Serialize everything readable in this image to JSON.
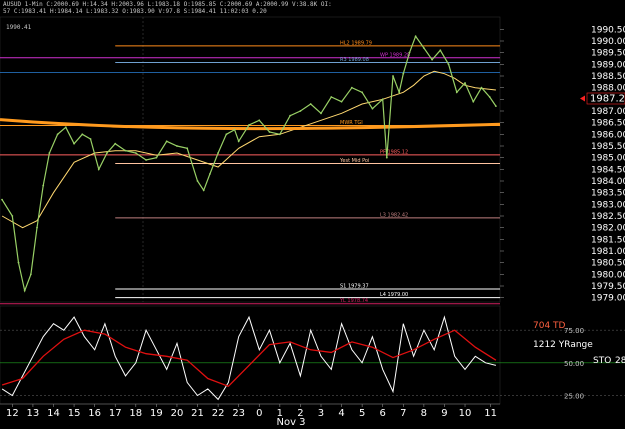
{
  "header": {
    "line1": "AUSUD 1-Min  C:2000.69  H:14.34  H:2003.96  L:1983.18  O:1985.85  C:2000.69  A:2000.99  V:38.8K  OI:",
    "line2": "57  C:1983.41  H:1984.14  L:1983.32  O:1983.90  V:97.8  S:1984.41  11:02:03  0.20"
  },
  "colors": {
    "background": "#000000",
    "price_line": "#99d066",
    "ma_orange": "#ff9a1e",
    "ma_yellow": "#ffd870",
    "osc_line": "#ffffff",
    "osc_signal": "#e01010",
    "osc_grid_green": "#1fa11f",
    "axis_text": "#ffffff",
    "last_price_box": "#ff2222"
  },
  "chart_data": [
    {
      "type": "line",
      "title": "",
      "ylim": [
        1978.9,
        1990.9
      ],
      "y_ticks": [
        "1990.50",
        "1990.00",
        "1989.50",
        "1989.00",
        "1988.50",
        "1988.00",
        "1987.50",
        "1987.00",
        "1986.50",
        "1986.00",
        "1985.50",
        "1985.00",
        "1984.50",
        "1984.00",
        "1983.50",
        "1983.00",
        "1982.50",
        "1982.00",
        "1981.50",
        "1981.00",
        "1980.50",
        "1980.00",
        "1979.50",
        "1979.00"
      ],
      "y_tick_values": [
        1990.5,
        1990.0,
        1989.5,
        1989.0,
        1988.5,
        1988.0,
        1987.5,
        1987.0,
        1986.5,
        1986.0,
        1985.5,
        1985.0,
        1984.5,
        1984.0,
        1983.5,
        1983.0,
        1982.5,
        1982.0,
        1981.5,
        1981.0,
        1980.5,
        1980.0,
        1979.5,
        1979.0
      ],
      "last_price": "1987.21",
      "last_price_value": 1987.21,
      "corner_label": "1990.41",
      "x_range": [
        11.4,
        35.7
      ],
      "price_series": {
        "x": [
          11.5,
          12,
          12.3,
          12.6,
          12.9,
          13.2,
          13.5,
          13.8,
          14.2,
          14.6,
          15,
          15.4,
          15.8,
          16.2,
          16.6,
          17,
          17.5,
          18,
          18.5,
          19,
          19.5,
          20,
          20.5,
          21,
          21.3,
          21.6,
          22,
          22.4,
          22.8,
          23,
          23.5,
          24,
          24.5,
          25,
          25.5,
          26,
          26.5,
          27,
          27.5,
          28,
          28.5,
          29,
          29.5,
          30,
          30.2,
          30.5,
          30.8,
          31,
          31.3,
          31.6,
          32,
          32.4,
          32.8,
          33.2,
          33.6,
          34,
          34.4,
          34.8,
          35.2,
          35.5
        ],
        "y": [
          1983.2,
          1982.5,
          1980.5,
          1979.3,
          1980.0,
          1982.0,
          1983.8,
          1985.2,
          1986.0,
          1986.3,
          1985.6,
          1986.0,
          1985.8,
          1984.5,
          1985.2,
          1985.6,
          1985.3,
          1985.2,
          1984.9,
          1985.0,
          1985.7,
          1985.5,
          1985.4,
          1984.0,
          1983.6,
          1984.3,
          1985.2,
          1986.0,
          1986.2,
          1985.7,
          1986.4,
          1986.6,
          1986.1,
          1986.0,
          1986.8,
          1987.0,
          1987.3,
          1986.9,
          1987.6,
          1987.4,
          1988.0,
          1987.8,
          1987.1,
          1987.5,
          1985.0,
          1988.5,
          1987.8,
          1988.6,
          1989.5,
          1990.2,
          1989.7,
          1989.2,
          1989.6,
          1989.0,
          1987.8,
          1988.2,
          1987.4,
          1988.0,
          1987.6,
          1987.21
        ]
      },
      "ma_series": {
        "x": [
          11.5,
          12.5,
          13.2,
          14,
          15,
          16,
          17,
          18,
          19,
          20,
          21,
          22,
          23,
          24,
          25,
          26,
          27,
          28,
          29,
          30,
          31,
          31.5,
          32,
          32.5,
          33,
          33.5,
          34,
          34.5,
          35.5
        ],
        "y": [
          1982.5,
          1982.0,
          1982.3,
          1983.5,
          1984.8,
          1985.2,
          1985.3,
          1985.3,
          1985.1,
          1985.2,
          1984.9,
          1984.6,
          1985.4,
          1985.9,
          1986.0,
          1986.3,
          1986.6,
          1986.9,
          1987.3,
          1987.5,
          1987.8,
          1988.1,
          1988.5,
          1988.7,
          1988.6,
          1988.4,
          1988.1,
          1988.0,
          1987.9
        ]
      },
      "levels": [
        {
          "label": "HL2 1989.79",
          "value": 1989.79,
          "color": "#ff8c1a",
          "x_start": 17.0
        },
        {
          "label": "WP 1989.28",
          "value": 1989.28,
          "color": "#d030d0",
          "x_start": 11.4
        },
        {
          "label": "R3 1989.08",
          "value": 1989.08,
          "color": "#6fa0d0",
          "x_start": 17.0
        },
        {
          "label": "",
          "value": 1988.65,
          "color": "#1f5f9f",
          "x_start": 11.4
        },
        {
          "label": "MWR TGI",
          "value": 1986.38,
          "color": "#ff9a1e",
          "x_start": 11.4
        },
        {
          "label": "PF 1985.12",
          "value": 1985.12,
          "color": "#ff5f5f",
          "x_start": 11.4
        },
        {
          "label": "Yest Mid Poi",
          "value": 1984.75,
          "color": "#ffc4a0",
          "x_start": 17.0
        },
        {
          "label": "L3 1982.42",
          "value": 1982.42,
          "color": "#c08080",
          "x_start": 17.0
        },
        {
          "label": "S1 1979.37",
          "value": 1979.37,
          "color": "#ffffff",
          "x_start": 17.0
        },
        {
          "label": "L4 1979.00",
          "value": 1979.0,
          "color": "#ffffff",
          "x_start": 17.0
        },
        {
          "label": "YL 1978.74",
          "value": 1978.74,
          "color": "#d02060",
          "x_start": 11.4
        }
      ]
    },
    {
      "type": "line",
      "title": "",
      "ylim": [
        20,
        92
      ],
      "y_ticks": [
        "75.00",
        "50.00",
        "25.00"
      ],
      "y_tick_values": [
        75,
        50,
        25
      ],
      "indicator_name": "STO",
      "indicator_value": "28",
      "annotations": [
        "704 TD",
        "1212 YRange"
      ],
      "stoch_series": {
        "x": [
          11.5,
          12,
          12.5,
          13,
          13.5,
          14,
          14.5,
          15,
          15.5,
          16,
          16.5,
          17,
          17.5,
          18,
          18.5,
          19,
          19.5,
          20,
          20.5,
          21,
          21.5,
          22,
          22.5,
          23,
          23.5,
          24,
          24.5,
          25,
          25.5,
          26,
          26.5,
          27,
          27.5,
          28,
          28.5,
          29,
          29.5,
          30,
          30.5,
          31,
          31.5,
          32,
          32.5,
          33,
          33.5,
          34,
          34.5,
          35,
          35.5
        ],
        "y": [
          30,
          25,
          40,
          55,
          70,
          80,
          75,
          85,
          70,
          60,
          80,
          55,
          40,
          50,
          75,
          60,
          45,
          65,
          35,
          25,
          30,
          22,
          35,
          70,
          85,
          60,
          75,
          50,
          65,
          40,
          75,
          55,
          45,
          80,
          60,
          50,
          70,
          45,
          28,
          80,
          55,
          75,
          60,
          85,
          55,
          45,
          55,
          50,
          48
        ]
      },
      "signal_series": {
        "x": [
          11.5,
          12.5,
          13.5,
          14.5,
          15.5,
          16.5,
          17.5,
          18.5,
          19.5,
          20.5,
          21.5,
          22.5,
          23.5,
          24.5,
          25.5,
          26.5,
          27.5,
          28.5,
          29.5,
          30.5,
          31.5,
          32.5,
          33.5,
          34.5,
          35.5
        ],
        "y": [
          33,
          38,
          55,
          68,
          75,
          72,
          62,
          57,
          55,
          52,
          38,
          32,
          48,
          64,
          66,
          60,
          58,
          66,
          62,
          54,
          60,
          68,
          75,
          62,
          52
        ]
      }
    }
  ],
  "x_axis": {
    "tick_labels": [
      "12",
      "13",
      "14",
      "15",
      "16",
      "17",
      "18",
      "19",
      "20",
      "21",
      "22",
      "23",
      "0",
      "1",
      "2",
      "3",
      "4",
      "5",
      "6",
      "7",
      "8",
      "9",
      "10",
      "11"
    ],
    "tick_values": [
      12,
      13,
      14,
      15,
      16,
      17,
      18,
      19,
      20,
      21,
      22,
      23,
      24,
      25,
      26,
      27,
      28,
      29,
      30,
      31,
      32,
      33,
      34,
      35
    ],
    "date_label": "Nov 3"
  }
}
